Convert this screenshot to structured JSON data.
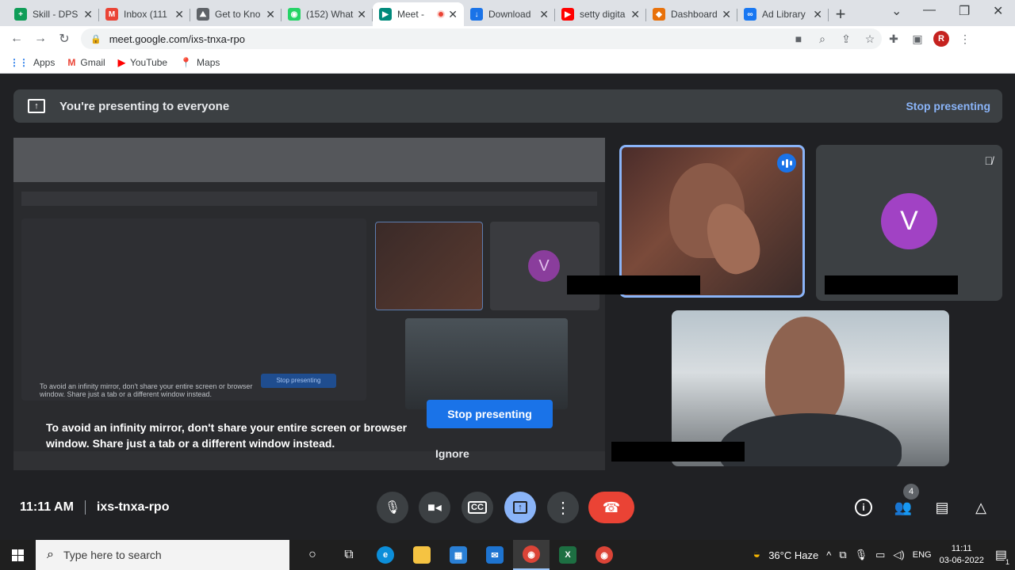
{
  "browser": {
    "tabs": [
      {
        "title": "Skill - DPS",
        "favicon_color": "#0f9d58",
        "glyph": "+"
      },
      {
        "title": "Inbox (111",
        "favicon_color": "#ea4335",
        "glyph": "M"
      },
      {
        "title": "Get to Kno",
        "favicon_color": "#5f6368",
        "glyph": "⛰"
      },
      {
        "title": "(152) What",
        "favicon_color": "#25d366",
        "glyph": "◉"
      },
      {
        "title": "Meet -",
        "favicon_color": "#00897b",
        "glyph": "▶"
      },
      {
        "title": "Download",
        "favicon_color": "#1a73e8",
        "glyph": "↓"
      },
      {
        "title": "setty digita",
        "favicon_color": "#ff0000",
        "glyph": "▶"
      },
      {
        "title": "Dashboard",
        "favicon_color": "#e8710a",
        "glyph": "◆"
      },
      {
        "title": "Ad Library",
        "favicon_color": "#1877f2",
        "glyph": "∞"
      }
    ],
    "active_tab_index": 4,
    "url": "meet.google.com/ixs-tnxa-rpo",
    "profile_initial": "R",
    "bookmarks": [
      {
        "label": "Apps",
        "icon": "apps-grid-icon",
        "color": "#1a73e8",
        "glyph": "⋮⋮"
      },
      {
        "label": "Gmail",
        "icon": "gmail-icon",
        "color": "#ea4335",
        "glyph": "M"
      },
      {
        "label": "YouTube",
        "icon": "youtube-icon",
        "color": "#ff0000",
        "glyph": "▶"
      },
      {
        "label": "Maps",
        "icon": "maps-pin-icon",
        "color": "#34a853",
        "glyph": "📍"
      }
    ]
  },
  "meet": {
    "banner_text": "You're presenting to everyone",
    "banner_stop": "Stop presenting",
    "participant_avatar_initial": "V",
    "mirror_warning": "To avoid an infinity mirror, don't share your entire screen or browser window. Share just a tab or a different window instead.",
    "stop_presenting_label": "Stop presenting",
    "ignore_label": "Ignore",
    "time": "11:11 AM",
    "meeting_code": "ixs-tnxa-rpo",
    "participant_count": "4"
  },
  "taskbar": {
    "search_placeholder": "Type here to search",
    "weather": "36°C  Haze",
    "language": "ENG",
    "clock_time": "11:11",
    "clock_date": "03-06-2022",
    "notification_count": "1"
  }
}
